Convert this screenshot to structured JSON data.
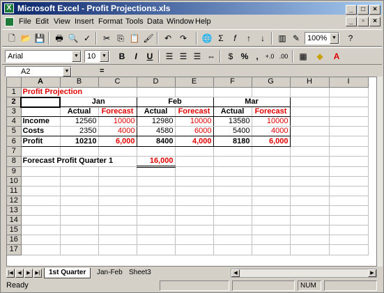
{
  "window": {
    "title": "Microsoft Excel - Profit Projections.xls",
    "app_icon": "excel-icon",
    "controls": [
      "_",
      "□",
      "×"
    ]
  },
  "menu": {
    "items": [
      "File",
      "Edit",
      "View",
      "Insert",
      "Format",
      "Tools",
      "Data",
      "Window",
      "Help"
    ],
    "doc_controls": [
      "_",
      "▫",
      "×"
    ]
  },
  "toolbar1": {
    "zoom": "100%",
    "buttons": [
      "new-icon",
      "open-icon",
      "save-icon",
      "print-icon",
      "print-preview-icon",
      "spelling-icon",
      "cut-icon",
      "copy-icon",
      "paste-icon",
      "format-painter-icon",
      "undo-icon",
      "redo-icon",
      "hyperlink-icon",
      "autosum-icon",
      "function-icon",
      "sort-ascending-icon",
      "sort-descending-icon",
      "chart-wizard-icon",
      "drawing-icon",
      "help-icon"
    ]
  },
  "toolbar2": {
    "font": "Arial",
    "font_size": "10",
    "bold": "B",
    "italic": "I",
    "underline": "U",
    "percent": "%",
    "comma": ","
  },
  "formula_bar": {
    "name_box": "A2",
    "equals": "=",
    "content": ""
  },
  "sheet": {
    "columns": [
      "A",
      "B",
      "C",
      "D",
      "E",
      "F",
      "G",
      "H",
      "I"
    ],
    "rows": [
      "1",
      "2",
      "3",
      "4",
      "5",
      "6",
      "7",
      "8",
      "9",
      "10",
      "11",
      "12",
      "13",
      "14",
      "15",
      "16",
      "17"
    ],
    "title": "Profit Projection",
    "months": [
      "Jan",
      "Feb",
      "Mar"
    ],
    "subheaders": [
      "Actual",
      "Forecast",
      "Actual",
      "Forecast",
      "Actual",
      "Forecast"
    ],
    "data": [
      {
        "label": "Income",
        "values": [
          "12560",
          "10000",
          "12980",
          "10000",
          "13580",
          "10000"
        ]
      },
      {
        "label": "Costs",
        "values": [
          "2350",
          "4000",
          "4580",
          "6000",
          "5400",
          "4000"
        ]
      },
      {
        "label": "Profit",
        "values": [
          "10210",
          "6,000",
          "8400",
          "4,000",
          "8180",
          "6,000"
        ]
      }
    ],
    "forecast_label": "Forecast Profit Quarter 1",
    "forecast_value": "16,000"
  },
  "tabs": {
    "items": [
      "1st Quarter",
      "Jan-Feb",
      "Sheet3"
    ],
    "active": "1st Quarter"
  },
  "status": {
    "text": "Ready",
    "num": "NUM"
  },
  "colors": {
    "title_bar": "#0a246a",
    "accent_red": "#e00000",
    "chrome": "#d4d0c8"
  }
}
